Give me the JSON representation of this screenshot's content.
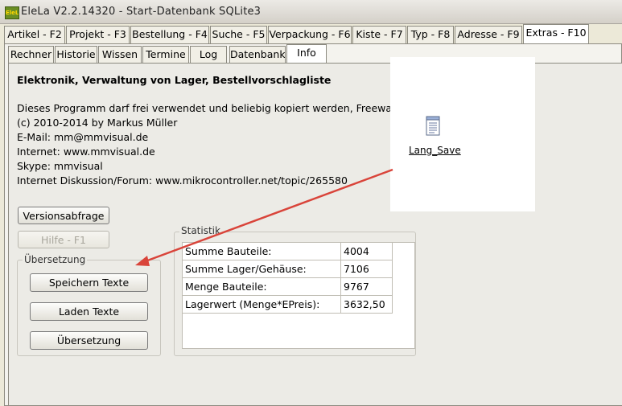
{
  "window": {
    "title": "EleLa V2.2.14320  - Start-Datenbank SQLite3",
    "icon_text": "EleLa"
  },
  "main_tabs": [
    {
      "label": "Artikel - F2"
    },
    {
      "label": "Projekt - F3"
    },
    {
      "label": "Bestellung - F4"
    },
    {
      "label": "Suche - F5"
    },
    {
      "label": "Verpackung - F6"
    },
    {
      "label": "Kiste - F7"
    },
    {
      "label": "Typ - F8"
    },
    {
      "label": "Adresse - F9"
    },
    {
      "label": "Extras - F10"
    }
  ],
  "sub_tabs": [
    {
      "label": "Rechner"
    },
    {
      "label": "Historie"
    },
    {
      "label": "Wissen"
    },
    {
      "label": "Termine"
    },
    {
      "label": "Log"
    },
    {
      "label": "Datenbank"
    },
    {
      "label": "Info"
    }
  ],
  "info": {
    "heading": "Elektronik, Verwaltung von Lager, Bestellvorschlagliste",
    "lines": [
      "Dieses Programm darf frei verwendet und beliebig kopiert werden, Freeware",
      "(c) 2010-2014 by Markus Müller",
      "E-Mail: mm@mmvisual.de",
      "Internet: www.mmvisual.de",
      "Skype: mmvisual",
      "Internet Diskussion/Forum: www.mikrocontroller.net/topic/265580"
    ]
  },
  "buttons": {
    "version": "Versionsabfrage",
    "help": "Hilfe - F1"
  },
  "translation": {
    "group_label": "Übersetzung",
    "save": "Speichern Texte",
    "load": "Laden Texte",
    "translate": "Übersetzung"
  },
  "statistics": {
    "group_label": "Statistik",
    "rows": [
      {
        "label": "Summe Bauteile:",
        "value": "4004"
      },
      {
        "label": "Summe Lager/Gehäuse:",
        "value": "7106"
      },
      {
        "label": "Menge Bauteile:",
        "value": "9767"
      },
      {
        "label": "Lagerwert (Menge*EPreis):",
        "value": "3632,50"
      }
    ]
  },
  "popup": {
    "file_label": "Lang_Save",
    "icon": "notepad-icon"
  },
  "colors": {
    "arrow": "#d9443a",
    "window_bg": "#ece9d8"
  }
}
